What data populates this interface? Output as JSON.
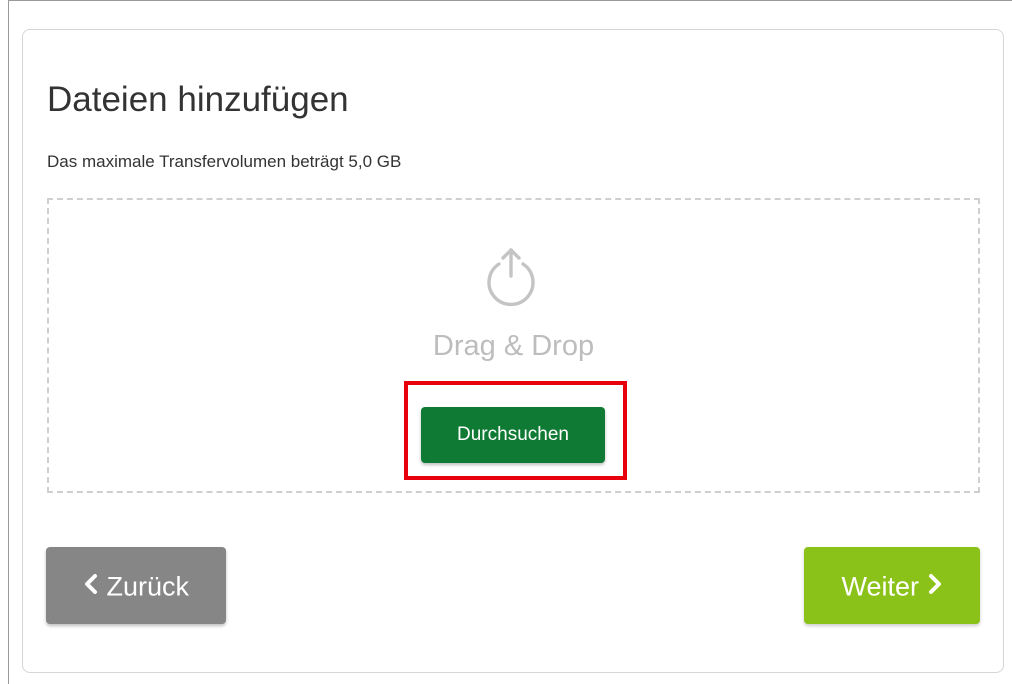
{
  "page": {
    "title": "Dateien hinzufügen",
    "subtitle": "Das maximale Transfervolumen beträgt 5,0 GB"
  },
  "dropzone": {
    "label": "Drag & Drop",
    "icon": "upload-icon",
    "browse_label": "Durchsuchen"
  },
  "nav": {
    "back_label": "Zurück",
    "back_icon": "chevron-left-icon",
    "next_label": "Weiter",
    "next_icon": "chevron-right-icon"
  },
  "colors": {
    "browse_button": "#0f7a33",
    "back_button": "#868686",
    "next_button": "#8bc21a",
    "highlight": "#e8000b"
  }
}
